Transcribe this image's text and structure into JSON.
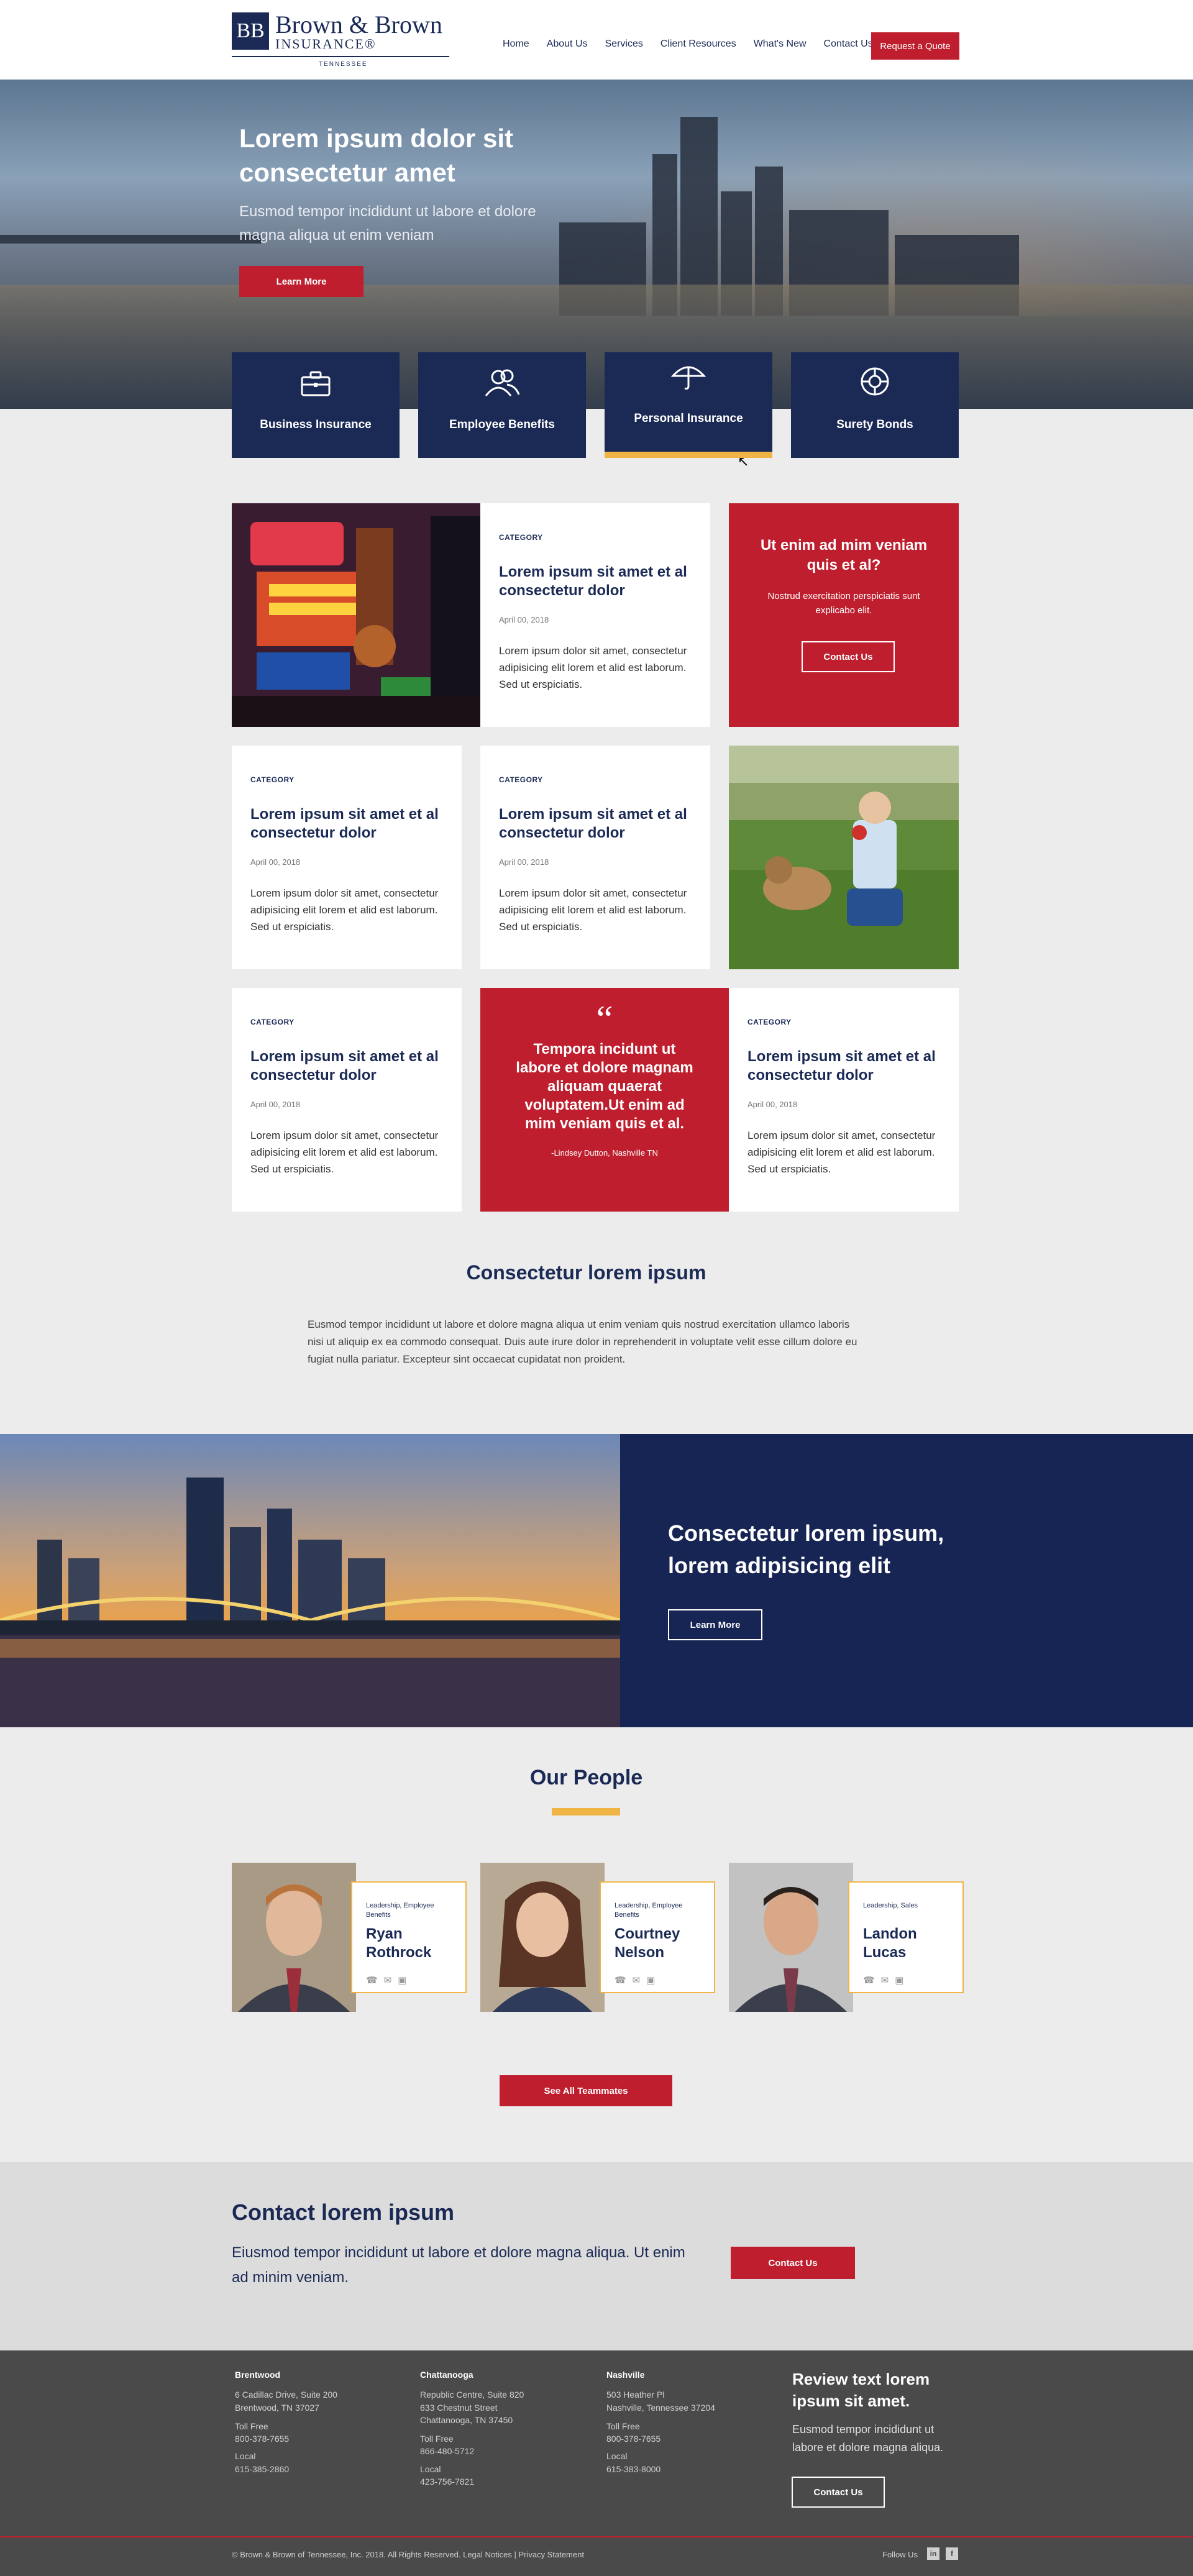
{
  "brand": {
    "mark": "BB",
    "name": "Brown & Brown",
    "sub": "INSURANCE®",
    "state": "TENNESSEE"
  },
  "nav": [
    "Home",
    "About Us",
    "Services",
    "Client Resources",
    "What's New",
    "Contact Us"
  ],
  "quote_button": "Request a Quote",
  "hero": {
    "title": "Lorem ipsum dolor sit consectetur amet",
    "subtitle": "Eusmod tempor incididunt ut labore et dolore magna aliqua ut enim veniam",
    "button": "Learn More"
  },
  "services": [
    {
      "label": "Business Insurance",
      "icon": "briefcase-icon"
    },
    {
      "label": "Employee Benefits",
      "icon": "people-icon"
    },
    {
      "label": "Personal Insurance",
      "icon": "umbrella-icon",
      "active": true
    },
    {
      "label": "Surety Bonds",
      "icon": "lifebuoy-icon"
    }
  ],
  "post": {
    "category": "CATEGORY",
    "title": "Lorem ipsum sit amet et al consectetur dolor",
    "date": "April 00, 2018",
    "excerpt": "Lorem ipsum dolor sit amet, consectetur adipisicing elit lorem et alid est laborum. Sed ut erspiciatis."
  },
  "cta_box": {
    "title": "Ut enim ad mim veniam quis et al?",
    "text": "Nostrud exercitation perspiciatis sunt explicabo elit.",
    "button": "Contact Us"
  },
  "testimonial": {
    "mark": "“",
    "quote": "Tempora incidunt ut labore et dolore magnam aliquam quaerat voluptatem.Ut enim ad mim veniam quis et al.",
    "author": "-Lindsey Dutton, Nashville TN"
  },
  "about": {
    "title": "Consectetur lorem ipsum",
    "text": "Eusmod tempor incididunt ut labore et dolore magna aliqua ut enim veniam quis nostrud exercitation ullamco laboris nisi ut aliquip ex ea commodo consequat. Duis aute irure dolor in reprehenderit in voluptate velit esse cillum dolore eu fugiat nulla pariatur. Excepteur sint occaecat cupidatat non proident."
  },
  "feature": {
    "title": "Consectetur lorem ipsum, lorem adipisicing elit",
    "button": "Learn More"
  },
  "people": {
    "title": "Our People",
    "members": [
      {
        "role": "Leadership, Employee Benefits",
        "name": "Ryan Rothrock"
      },
      {
        "role": "Leadership, Employee Benefits",
        "name": "Courtney Nelson"
      },
      {
        "role": "Leadership, Sales",
        "name": "Landon Lucas"
      }
    ],
    "button": "See All Teammates"
  },
  "contact": {
    "title": "Contact lorem ipsum",
    "text": "Eiusmod tempor incididunt ut labore et dolore magna aliqua. Ut enim ad minim veniam.",
    "button": "Contact Us"
  },
  "footer": {
    "offices": [
      {
        "name": "Brentwood",
        "address1": "6 Cadillac Drive, Suite 200",
        "address2": "Brentwood, TN 37027",
        "address3": "",
        "tollfree_label": "Toll Free",
        "tollfree": "800-378-7655",
        "local_label": "Local",
        "local": "615-385-2860"
      },
      {
        "name": "Chattanooga",
        "address1": "Republic Centre, Suite 820",
        "address2": "633 Chestnut Street",
        "address3": "Chattanooga, TN 37450",
        "tollfree_label": "Toll Free",
        "tollfree": "866-480-5712",
        "local_label": "Local",
        "local": "423-756-7821"
      },
      {
        "name": "Nashville",
        "address1": "503 Heather Pl",
        "address2": "Nashville, Tennessee 37204",
        "address3": "",
        "tollfree_label": "Toll Free",
        "tollfree": "800-378-7655",
        "local_label": "Local",
        "local": "615-383-8000"
      }
    ],
    "review": {
      "title": "Review text lorem ipsum sit amet.",
      "text": "Eusmod tempor incididunt ut labore et dolore magna aliqua.",
      "button": "Contact Us"
    },
    "copyright": "© Brown & Brown of Tennessee, Inc. 2018. All Rights Reserved. Legal Notices   |   Privacy Statement",
    "follow": "Follow Us",
    "social": [
      "in",
      "f"
    ]
  },
  "colors": {
    "navy": "#1b2a55",
    "red": "#be1e2d",
    "gold": "#f0b445"
  }
}
